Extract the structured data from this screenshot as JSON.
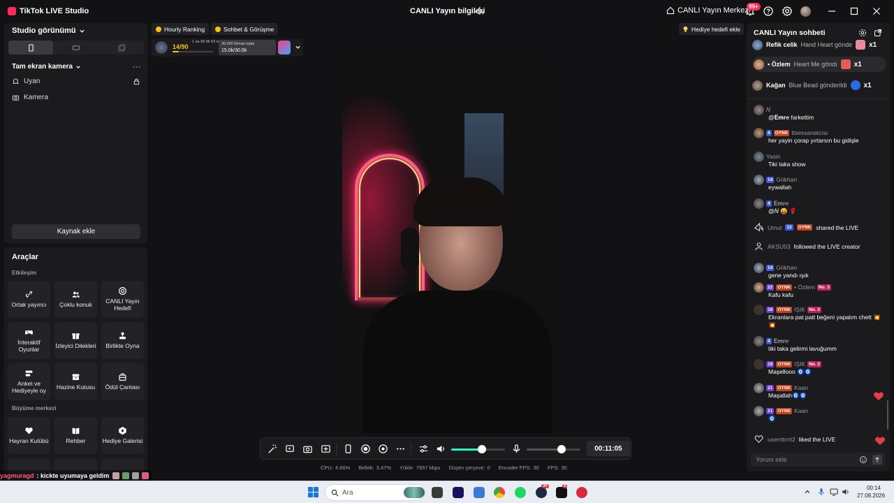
{
  "app": {
    "title": "TikTok LIVE Studio",
    "center_title": "CANLI Yayın bilgileri",
    "live_center_label": "CANLI Yayın Merkezi",
    "notification_count": "99+"
  },
  "left": {
    "view_label": "Studio görünümü",
    "camera_section_label": "Tam ekran kamera",
    "sources": [
      {
        "label": "Uyan",
        "icon": "bell-icon"
      },
      {
        "label": "Kamera",
        "icon": "camera-icon"
      }
    ],
    "add_source_label": "Kaynak ekle",
    "tools_title": "Araçlar",
    "section_interaction": "Etkileşim",
    "section_growth": "Büyüme merkezi",
    "tools": [
      {
        "label": "Ortak yayıncı",
        "icon": "link-icon"
      },
      {
        "label": "Çoklu konuk",
        "icon": "users-icon"
      },
      {
        "label": "CANLI Yayın Hedefi",
        "icon": "target-icon"
      },
      {
        "label": "İnteraktif Oyunlar",
        "icon": "gamepad-icon"
      },
      {
        "label": "İzleyici Dilekleri",
        "icon": "gift-icon"
      },
      {
        "label": "Birlikte Oyna",
        "icon": "joystick-icon"
      },
      {
        "label": "Anket ve Hediyeyle oy",
        "icon": "poll-icon"
      },
      {
        "label": "Hazine Kutusu",
        "icon": "treasure-icon"
      },
      {
        "label": "Ödül Çantası",
        "icon": "bag-icon"
      },
      {
        "label": "Hayran Kulübü",
        "icon": "heart-icon"
      },
      {
        "label": "Rehber",
        "icon": "book-icon"
      },
      {
        "label": "Hediye Galerisi",
        "icon": "gallery-icon"
      }
    ]
  },
  "ticker": {
    "user": "yagmuragd",
    "text": ": kickte uyumaya geldim"
  },
  "top_chips": {
    "hourly_ranking": "Hourly Ranking",
    "chat_call": "Sohbet & Görüşme",
    "gift_target": "Hediye hedefi ekle",
    "rank_count": "14/90",
    "rank_timer": "1 sa 39 dk 53 sn",
    "rank_progress": 0.16,
    "gift_title": "30.000 Elmas topla",
    "gift_progress_text": "15.0k/30.0k"
  },
  "controls": {
    "timer": "00:11:05",
    "speaker_volume": 0.57,
    "mic_volume": 0.65
  },
  "stats": [
    {
      "label": "CPU:",
      "value": "4.66%"
    },
    {
      "label": "Bellek:",
      "value": "3.47%"
    },
    {
      "label": "Yükle:",
      "value": "7957 kbps"
    },
    {
      "label": "Düşen çerçeve:",
      "value": "0"
    },
    {
      "label": "Encoder FPS:",
      "value": "30"
    },
    {
      "label": "FPS:",
      "value": "30"
    }
  ],
  "chat": {
    "title": "CANLI Yayın sohbeti",
    "gifts": [
      {
        "name": "Refik celik",
        "text": "Hand Heart gönde",
        "mult": "x1"
      },
      {
        "name": "• Özlem",
        "text": "Heart Me göndı",
        "mult": "x1"
      },
      {
        "name": "Kağan",
        "text": "Blue Bead gönderildi",
        "mult": "x1"
      }
    ],
    "messages": [
      {
        "user": "𝑁",
        "lvl": "",
        "fan": "",
        "extra": "",
        "no": "",
        "text": "@𝐄𝐦𝐫𝐞 farkettim"
      },
      {
        "user": "ttsexsanatcısı",
        "lvl": "4",
        "fan": "OYNK",
        "extra": "",
        "no": "",
        "text": "her yayin çorap yırtarsın bu gidişle"
      },
      {
        "user": "Yasin",
        "lvl": "",
        "fan": "",
        "extra": "",
        "no": "",
        "text": "Tiki taka show"
      },
      {
        "user": "Gökhan",
        "lvl": "14",
        "fan": "",
        "extra": "",
        "no": "",
        "text": "eywallah"
      },
      {
        "user": "𝐄𝐦𝐫𝐞",
        "lvl": "4",
        "fan": "",
        "extra": "",
        "no": "",
        "text": "@𝑁 😝 🌹"
      },
      {
        "user": "Gökhan",
        "lvl": "14",
        "fan": "",
        "extra": "",
        "no": "",
        "text": "gene yandı ışık"
      },
      {
        "user": "• Özlem",
        "lvl": "22",
        "fan": "OYNK",
        "extra": "",
        "no": "No. 3",
        "text": "Kafu kafu"
      },
      {
        "user": "IŞIK",
        "lvl": "18",
        "fan": "OYNK",
        "extra": "",
        "no": "No. 2",
        "text": "Ekranlara pat patt beğeni yapalım chett 💥💥"
      },
      {
        "user": "𝐄𝐦𝐫𝐞",
        "lvl": "4",
        "fan": "",
        "extra": "",
        "no": "",
        "text": "tiki taka gelirmi lavuğumm"
      },
      {
        "user": "IŞIK",
        "lvl": "18",
        "fan": "OYNK",
        "extra": "",
        "no": "No. 2",
        "text": "Maşellooo 🧿🧿"
      },
      {
        "user": "Kaan",
        "lvl": "21",
        "fan": "OYNK",
        "extra": "",
        "no": "",
        "text": "Maşallah🧿🧿"
      },
      {
        "user": "Kaan",
        "lvl": "21",
        "fan": "OYNK",
        "extra": "",
        "no": "",
        "text": "🧿"
      }
    ],
    "events": [
      {
        "user": "Umut",
        "lvl": "13",
        "fan": "OYNK",
        "text": "shared the LIVE"
      },
      {
        "user": "AKSU53",
        "lvl": "",
        "fan": "",
        "text": "followed the LIVE creator"
      },
      {
        "user": "userrttrrrt2",
        "lvl": "",
        "fan": "",
        "text": "liked the LIVE"
      }
    ],
    "input_placeholder": "Yorum ekle"
  },
  "taskbar": {
    "search_label": "Ara",
    "time": "00:14",
    "date": "27.08.2026",
    "badges": {
      "steam": "30",
      "tiktok": "8"
    }
  },
  "colors": {
    "accent": "#fe2c55",
    "teal": "#25f4c3",
    "panel": "#1b1b1e",
    "background": "#121214"
  }
}
